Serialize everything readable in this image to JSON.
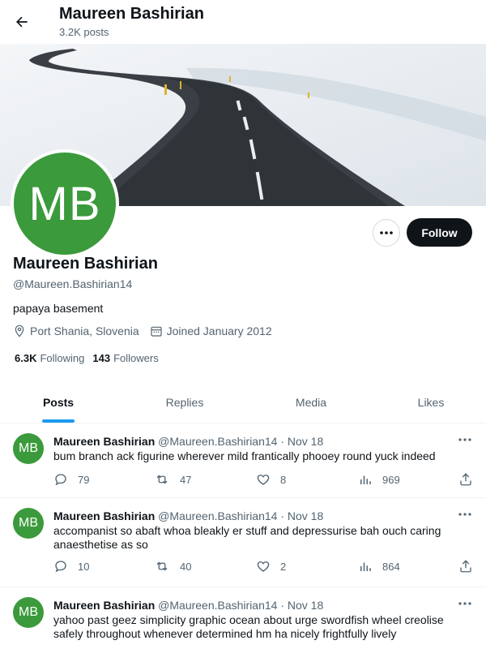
{
  "header": {
    "name": "Maureen Bashirian",
    "posts_count": "3.2K posts"
  },
  "profile": {
    "avatar_initials": "MB",
    "name": "Maureen Bashirian",
    "handle": "@Maureen.Bashirian14",
    "bio": "papaya basement",
    "location": "Port Shania, Slovenia",
    "joined": "Joined January 2012",
    "following_count": "6.3K",
    "following_label": "Following",
    "followers_count": "143",
    "followers_label": "Followers",
    "follow_label": "Follow"
  },
  "tabs": [
    {
      "label": "Posts",
      "active": true
    },
    {
      "label": "Replies",
      "active": false
    },
    {
      "label": "Media",
      "active": false
    },
    {
      "label": "Likes",
      "active": false
    }
  ],
  "posts": [
    {
      "avatar": "MB",
      "name": "Maureen Bashirian",
      "handle": "@Maureen.Bashirian14",
      "date": "· Nov 18",
      "text": "bum branch ack figurine wherever mild frantically phooey round yuck indeed",
      "replies": "79",
      "reposts": "47",
      "likes": "8",
      "views": "969"
    },
    {
      "avatar": "MB",
      "name": "Maureen Bashirian",
      "handle": "@Maureen.Bashirian14",
      "date": "· Nov 18",
      "text": "accompanist so abaft whoa bleakly er stuff and depressurise bah ouch caring anaesthetise as so",
      "replies": "10",
      "reposts": "40",
      "likes": "2",
      "views": "864"
    },
    {
      "avatar": "MB",
      "name": "Maureen Bashirian",
      "handle": "@Maureen.Bashirian14",
      "date": "· Nov 18",
      "text": "yahoo past geez simplicity graphic ocean about urge swordfish wheel creolise safely throughout whenever determined hm ha nicely frightfully lively",
      "replies": "",
      "reposts": "",
      "likes": "",
      "views": ""
    }
  ],
  "colors": {
    "accent": "#1d9bf0",
    "avatar_bg": "#3b9a3b",
    "follow_bg": "#0f1419",
    "muted": "#536471"
  }
}
